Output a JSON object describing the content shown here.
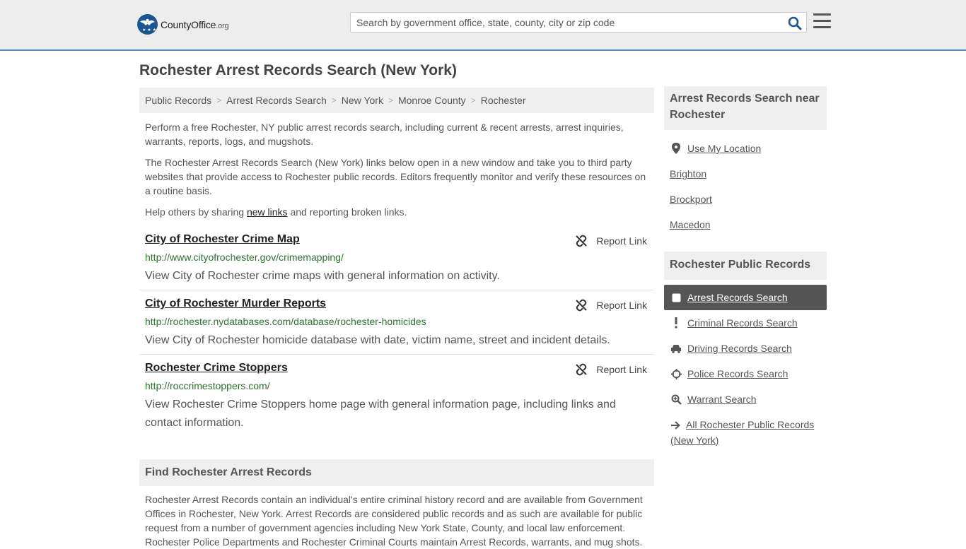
{
  "header": {
    "logo_main": "CountyOffice",
    "logo_suffix": ".org",
    "search_placeholder": "Search by government office, state, county, city or zip code"
  },
  "page_title": "Rochester Arrest Records Search (New York)",
  "breadcrumb": [
    "Public Records",
    "Arrest Records Search",
    "New York",
    "Monroe County",
    "Rochester"
  ],
  "intro": {
    "p1": "Perform a free Rochester, NY public arrest records search, including current & recent arrests, arrest inquiries, warrants, reports, logs, and mugshots.",
    "p2": "The Rochester Arrest Records Search (New York) links below open in a new window and take you to third party websites that provide access to Rochester public records. Editors frequently monitor and verify these resources on a routine basis.",
    "p3_before": "Help others by sharing ",
    "p3_link": "new links",
    "p3_after": " and reporting broken links."
  },
  "listings": [
    {
      "title": "City of Rochester Crime Map",
      "url": "http://www.cityofrochester.gov/crimemapping/",
      "description": "View City of Rochester crime maps with general information on activity.",
      "report_label": "Report Link"
    },
    {
      "title": "City of Rochester Murder Reports",
      "url": "http://rochester.nydatabases.com/database/rochester-homicides",
      "description": "View City of Rochester homicide database with date, victim name, street and incident details.",
      "report_label": "Report Link"
    },
    {
      "title": "Rochester Crime Stoppers",
      "url": "http://roccrimestoppers.com/",
      "description": "View Rochester Crime Stoppers home page with general information page, including links and contact information.",
      "report_label": "Report Link"
    }
  ],
  "find_section": {
    "heading": "Find Rochester Arrest Records",
    "body": "Rochester Arrest Records contain an individual's entire criminal history record and are available from Government Offices in Rochester, New York. Arrest Records are considered public records and as such are available for public request from a number of government agencies including New York State, County, and local law enforcement. Rochester Police Departments and Rochester Criminal Courts maintain Arrest Records, warrants, and mug shots."
  },
  "sidebar": {
    "nearby_heading": "Arrest Records Search near Rochester",
    "use_location": "Use My Location",
    "nearby": [
      "Brighton",
      "Brockport",
      "Macedon"
    ],
    "public_heading": "Rochester Public Records",
    "records": [
      {
        "label": "Arrest Records Search",
        "icon": "square-icon",
        "active": true
      },
      {
        "label": "Criminal Records Search",
        "icon": "exclamation-icon",
        "active": false
      },
      {
        "label": "Driving Records Search",
        "icon": "car-icon",
        "active": false
      },
      {
        "label": "Police Records Search",
        "icon": "crosshair-icon",
        "active": false
      },
      {
        "label": "Warrant Search",
        "icon": "magnify-icon",
        "active": false
      }
    ],
    "all_records": "All Rochester Public Records (New York)"
  },
  "colors": {
    "accent_border": "#5b8cc7",
    "url_green": "#267a26",
    "active_bg": "#555555",
    "logo_blue": "#1c5594"
  }
}
